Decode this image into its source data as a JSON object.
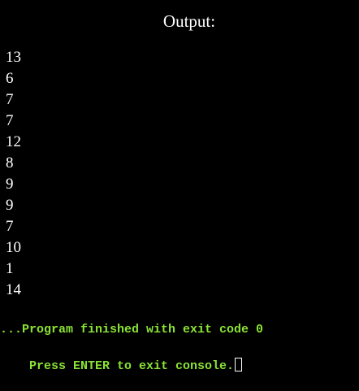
{
  "header": {
    "title": "Output:"
  },
  "output": {
    "lines": [
      "13",
      "6",
      "7",
      "7",
      "12",
      "8",
      "9",
      "9",
      "7",
      "10",
      "1",
      "14"
    ]
  },
  "status": {
    "finished_text": "...Program finished with exit code 0",
    "prompt_text": "Press ENTER to exit console.",
    "text_color": "#8ae234",
    "cursor_color": "#ffffff"
  }
}
